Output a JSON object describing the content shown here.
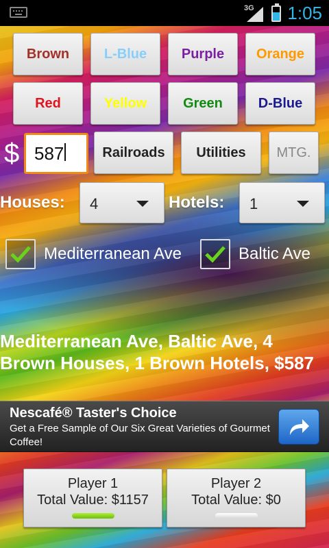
{
  "status_bar": {
    "network": "3G",
    "time": "1:05",
    "icons": [
      "keyboard-icon",
      "signal-icon",
      "battery-charging-icon"
    ]
  },
  "colors": {
    "brown": "#a3312a",
    "lblue": "#87cefa",
    "purple": "#7b1fa2",
    "orange": "#ff9900",
    "red": "#e0141e",
    "yellow": "#ffff00",
    "green": "#128a12",
    "dblue": "#1a1a8f",
    "accent_focus": "#f08a12",
    "player1_indicator": "#8ccf1a",
    "player2_indicator": "#f0f0f0"
  },
  "color_buttons": [
    {
      "label": "Brown"
    },
    {
      "label": "L-Blue"
    },
    {
      "label": "Purple"
    },
    {
      "label": "Orange"
    },
    {
      "label": "Red"
    },
    {
      "label": "Yellow"
    },
    {
      "label": "Green"
    },
    {
      "label": "D-Blue"
    }
  ],
  "amount": {
    "currency_symbol": "$",
    "value": "587"
  },
  "actions": {
    "railroads": "Railroads",
    "utilities": "Utilities",
    "mortgage": "MTG."
  },
  "houses": {
    "label": "Houses:",
    "value": "4"
  },
  "hotels": {
    "label": "Hotels:",
    "value": "1"
  },
  "properties": [
    {
      "label": "Mediterranean Ave",
      "checked": true
    },
    {
      "label": "Baltic Ave",
      "checked": true
    }
  ],
  "summary": "Mediterranean Ave, Baltic Ave, 4 Brown Houses, 1 Brown Hotels, $587",
  "ad": {
    "title": "Nescafé® Taster's Choice",
    "body": "Get a Free Sample of Our Six Great Varieties of Gourmet Coffee!",
    "icon": "share-arrow-icon"
  },
  "players": [
    {
      "name": "Player 1",
      "total": "Total Value: $1157",
      "active": true
    },
    {
      "name": "Player 2",
      "total": "Total Value: $0",
      "active": false
    }
  ]
}
